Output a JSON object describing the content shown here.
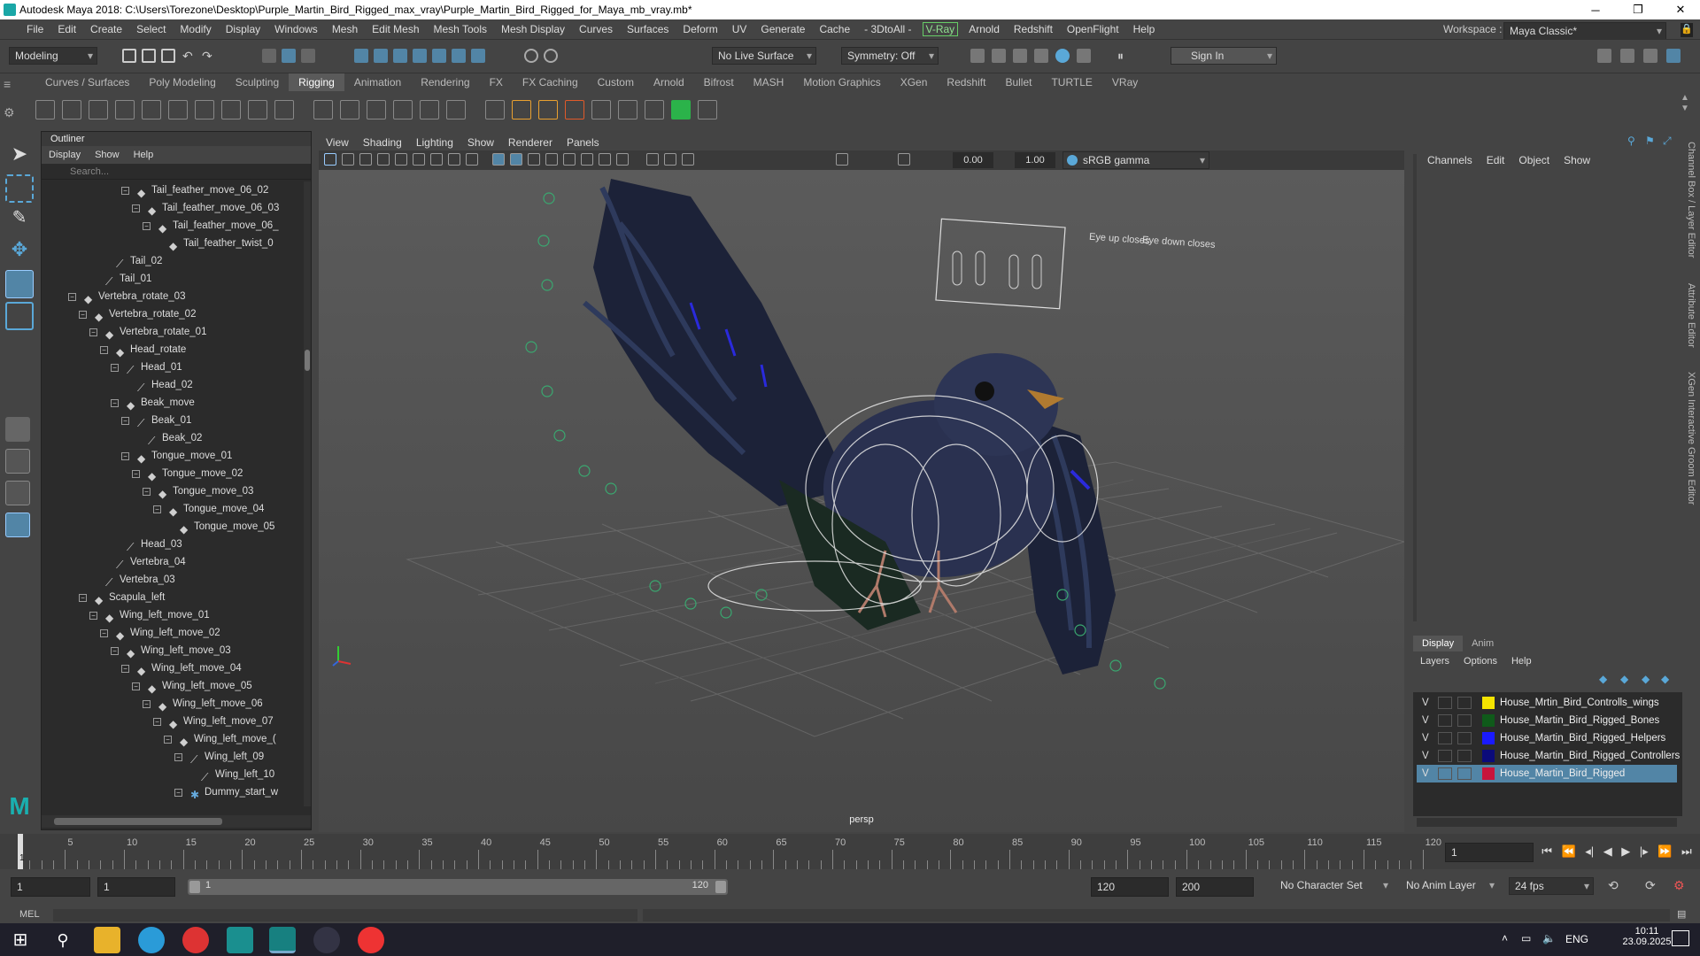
{
  "window": {
    "title": "Autodesk Maya 2018: C:\\Users\\Torezone\\Desktop\\Purple_Martin_Bird_Rigged_max_vray\\Purple_Martin_Bird_Rigged_for_Maya_mb_vray.mb*"
  },
  "menubar": {
    "items": [
      "File",
      "Edit",
      "Create",
      "Select",
      "Modify",
      "Display",
      "Windows",
      "Mesh",
      "Edit Mesh",
      "Mesh Tools",
      "Mesh Display",
      "Curves",
      "Surfaces",
      "Deform",
      "UV",
      "Generate",
      "Cache",
      "- 3DtoAll -"
    ],
    "vray": "V-Ray",
    "items2": [
      "Arnold",
      "Redshift",
      "OpenFlight",
      "Help"
    ],
    "workspace_label": "Workspace :",
    "workspace_value": "Maya Classic*"
  },
  "statusline": {
    "mode": "Modeling",
    "live_surface": "No Live Surface",
    "symmetry": "Symmetry: Off",
    "sign_in": "Sign In"
  },
  "shelf": {
    "tabs": [
      "Curves / Surfaces",
      "Poly Modeling",
      "Sculpting",
      "Rigging",
      "Animation",
      "Rendering",
      "FX",
      "FX Caching",
      "Custom",
      "Arnold",
      "Bifrost",
      "MASH",
      "Motion Graphics",
      "XGen",
      "Redshift",
      "Bullet",
      "TURTLE",
      "VRay"
    ],
    "active": "Rigging"
  },
  "outliner": {
    "title": "Outliner",
    "menu": [
      "Display",
      "Show",
      "Help"
    ],
    "search_placeholder": "Search...",
    "rows": [
      {
        "label": "Tail_feather_move_06_02",
        "icon": "joint",
        "depth": 9,
        "exp": "-"
      },
      {
        "label": "Tail_feather_move_06_03",
        "icon": "joint",
        "depth": 10,
        "exp": "-"
      },
      {
        "label": "Tail_feather_move_06_",
        "icon": "joint",
        "depth": 11,
        "exp": "-"
      },
      {
        "label": "Tail_feather_twist_0",
        "icon": "joint",
        "depth": 12,
        "exp": ""
      },
      {
        "label": "Tail_02",
        "icon": "bone",
        "depth": 7,
        "exp": ""
      },
      {
        "label": "Tail_01",
        "icon": "bone",
        "depth": 6,
        "exp": ""
      },
      {
        "label": "Vertebra_rotate_03",
        "icon": "joint",
        "depth": 4,
        "exp": "-"
      },
      {
        "label": "Vertebra_rotate_02",
        "icon": "joint",
        "depth": 5,
        "exp": "-"
      },
      {
        "label": "Vertebra_rotate_01",
        "icon": "joint",
        "depth": 6,
        "exp": "-"
      },
      {
        "label": "Head_rotate",
        "icon": "joint",
        "depth": 7,
        "exp": "-"
      },
      {
        "label": "Head_01",
        "icon": "bone",
        "depth": 8,
        "exp": "-"
      },
      {
        "label": "Head_02",
        "icon": "bone",
        "depth": 9,
        "exp": ""
      },
      {
        "label": "Beak_move",
        "icon": "joint",
        "depth": 8,
        "exp": "-"
      },
      {
        "label": "Beak_01",
        "icon": "bone",
        "depth": 9,
        "exp": "-"
      },
      {
        "label": "Beak_02",
        "icon": "bone",
        "depth": 10,
        "exp": ""
      },
      {
        "label": "Tongue_move_01",
        "icon": "joint",
        "depth": 9,
        "exp": "-"
      },
      {
        "label": "Tongue_move_02",
        "icon": "joint",
        "depth": 10,
        "exp": "-"
      },
      {
        "label": "Tongue_move_03",
        "icon": "joint",
        "depth": 11,
        "exp": "-"
      },
      {
        "label": "Tongue_move_04",
        "icon": "joint",
        "depth": 12,
        "exp": "-"
      },
      {
        "label": "Tongue_move_05",
        "icon": "joint",
        "depth": 13,
        "exp": ""
      },
      {
        "label": "Head_03",
        "icon": "bone",
        "depth": 8,
        "exp": ""
      },
      {
        "label": "Vertebra_04",
        "icon": "bone",
        "depth": 7,
        "exp": ""
      },
      {
        "label": "Vertebra_03",
        "icon": "bone",
        "depth": 6,
        "exp": ""
      },
      {
        "label": "Scapula_left",
        "icon": "joint",
        "depth": 5,
        "exp": "-"
      },
      {
        "label": "Wing_left_move_01",
        "icon": "joint",
        "depth": 6,
        "exp": "-"
      },
      {
        "label": "Wing_left_move_02",
        "icon": "joint",
        "depth": 7,
        "exp": "-"
      },
      {
        "label": "Wing_left_move_03",
        "icon": "joint",
        "depth": 8,
        "exp": "-"
      },
      {
        "label": "Wing_left_move_04",
        "icon": "joint",
        "depth": 9,
        "exp": "-"
      },
      {
        "label": "Wing_left_move_05",
        "icon": "joint",
        "depth": 10,
        "exp": "-"
      },
      {
        "label": "Wing_left_move_06",
        "icon": "joint",
        "depth": 11,
        "exp": "-"
      },
      {
        "label": "Wing_left_move_07",
        "icon": "joint",
        "depth": 12,
        "exp": "-"
      },
      {
        "label": "Wing_left_move_(",
        "icon": "joint",
        "depth": 13,
        "exp": "-"
      },
      {
        "label": "Wing_left_09",
        "icon": "bone",
        "depth": 14,
        "exp": "-"
      },
      {
        "label": "Wing_left_10",
        "icon": "bone",
        "depth": 15,
        "exp": ""
      },
      {
        "label": "Dummy_start_w",
        "icon": "dummy",
        "depth": 14,
        "exp": "-"
      }
    ]
  },
  "viewport": {
    "menu": [
      "View",
      "Shading",
      "Lighting",
      "Show",
      "Renderer",
      "Panels"
    ],
    "exposure": "0.00",
    "gamma": "1.00",
    "colorspace": "sRGB gamma",
    "camera": "persp",
    "eye_panel": {
      "left_label": "Eye up closes",
      "right_label": "Eye down closes"
    }
  },
  "channelbox": {
    "menu": [
      "Channels",
      "Edit",
      "Object",
      "Show"
    ]
  },
  "sidetabs": [
    "Channel Box / Layer Editor",
    "Attribute Editor",
    "XGen Interactive Groom Editor"
  ],
  "layereditor": {
    "tabs": [
      "Display",
      "Anim"
    ],
    "active_tab": "Display",
    "menu": [
      "Layers",
      "Options",
      "Help"
    ],
    "layers": [
      {
        "v": "V",
        "name": "House_Mrtin_Bird_Controlls_wings",
        "color": "#f5e400"
      },
      {
        "v": "V",
        "name": "House_Martin_Bird_Rigged_Bones",
        "color": "#0f5a1a"
      },
      {
        "v": "V",
        "name": "House_Martin_Bird_Rigged_Helpers",
        "color": "#1a1aff"
      },
      {
        "v": "V",
        "name": "House_Martin_Bird_Rigged_Controllers",
        "color": "#0b0b7a"
      },
      {
        "v": "V",
        "name": "House_Martin_Bird_Rigged",
        "color": "#c8143c",
        "selected": true
      }
    ]
  },
  "timeslider": {
    "ticks": [
      "5",
      "10",
      "15",
      "20",
      "25",
      "30",
      "35",
      "40",
      "45",
      "50",
      "55",
      "60",
      "65",
      "70",
      "75",
      "80",
      "85",
      "90",
      "95",
      "100",
      "105",
      "110",
      "115",
      "120"
    ],
    "start_marker": "1",
    "current_frame": "1"
  },
  "rangeslider": {
    "start": "1",
    "playback_start": "1",
    "range_start": "1",
    "range_end": "120",
    "playback_end": "120",
    "end": "200",
    "character_set": "No Character Set",
    "anim_layer": "No Anim Layer",
    "fps": "24 fps"
  },
  "mel": {
    "label": "MEL"
  },
  "taskbar": {
    "lang": "ENG",
    "time": "10:11",
    "date": "23.09.2025"
  },
  "colors": {
    "accent": "#5285a6",
    "selection": "#5285a6",
    "vray_green": "#6c6"
  }
}
